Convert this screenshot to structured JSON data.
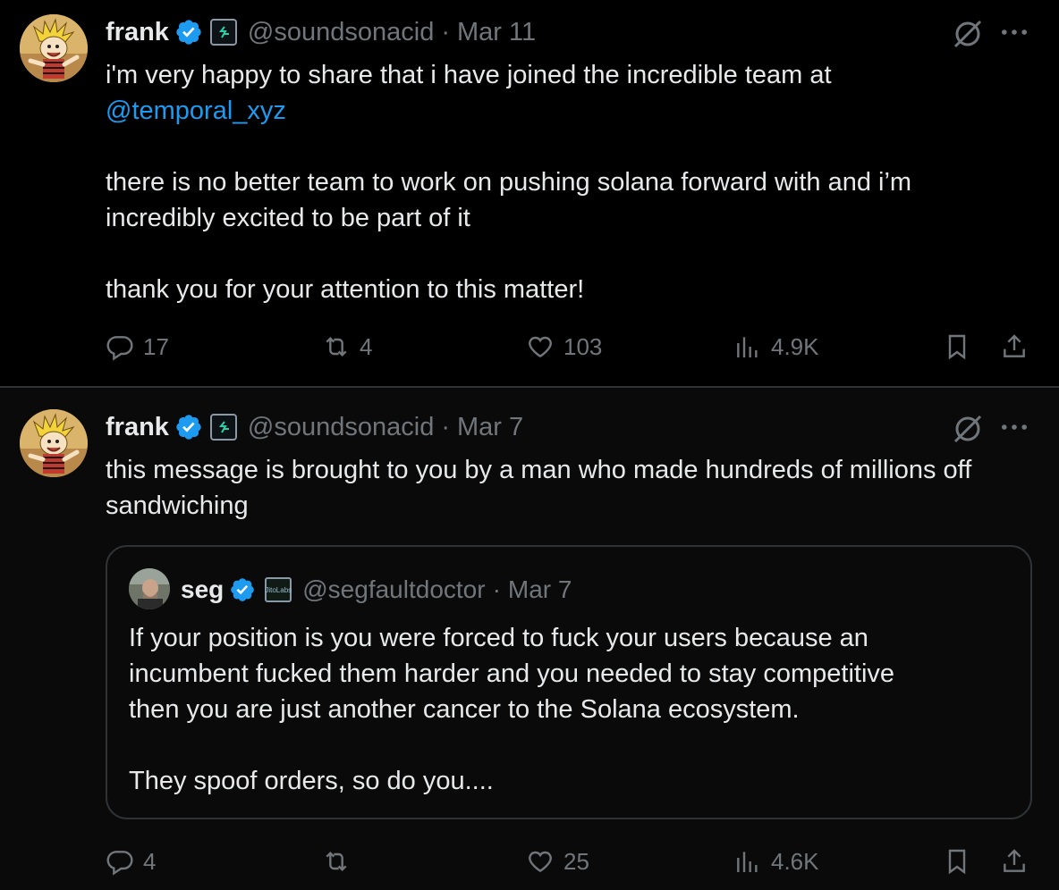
{
  "tweets": [
    {
      "name": "frank",
      "handle": "@soundsonacid",
      "separator": "·",
      "date": "Mar 11",
      "text_before_mention": "i'm very happy to share that i have joined the incredible team at\n",
      "mention": "@temporal_xyz",
      "text_after_mention": "\n\nthere is no better team to work on pushing solana forward with and i’m\nincredibly excited to be part of it\n\nthank you for your attention to this matter!",
      "replies": "17",
      "reposts": "4",
      "likes": "103",
      "views": "4.9K"
    },
    {
      "name": "frank",
      "handle": "@soundsonacid",
      "separator": "·",
      "date": "Mar 7",
      "text": "this message is brought to you by a man who made hundreds of millions off\nsandwiching",
      "quote": {
        "name": "seg",
        "handle": "@segfaultdoctor",
        "separator": "·",
        "date": "Mar 7",
        "affiliate_badge_text": "JitoLabs",
        "text": "If your position is you were forced to fuck your users because an\nincumbent fucked them harder and you needed to stay competitive\nthen you are just another cancer to the Solana ecosystem.\n\nThey spoof orders, so do you...."
      },
      "replies": "4",
      "reposts": "",
      "likes": "25",
      "views": "4.6K"
    }
  ],
  "colors": {
    "background": "#000000",
    "text": "#e7e9ea",
    "secondary": "#71767b",
    "accent": "#1d9bf0",
    "border": "#2f3336"
  },
  "icons": [
    "verified-badge-icon",
    "affiliate-badge-icon",
    "grok-icon",
    "more-icon",
    "reply-icon",
    "repost-icon",
    "like-icon",
    "views-icon",
    "bookmark-icon",
    "share-icon"
  ]
}
